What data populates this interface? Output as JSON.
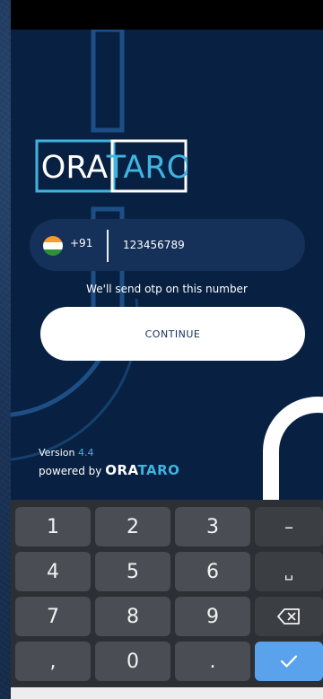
{
  "logo": {
    "text_left": "ORA",
    "text_right": "TARO"
  },
  "phone": {
    "country_code": "+91",
    "number": "123456789",
    "flag": "india-flag-icon"
  },
  "otp_note": "We'll send otp on this number",
  "continue_label": "CONTINUE",
  "footer": {
    "version_label": "Version",
    "version_number": "4.4",
    "powered_label": "powered by",
    "brand_left": "ORA",
    "brand_right": "TARO"
  },
  "keyboard": {
    "rows": [
      [
        "1",
        "2",
        "3",
        "–"
      ],
      [
        "4",
        "5",
        "6",
        "␣"
      ],
      [
        "7",
        "8",
        "9",
        "backspace-icon"
      ],
      [
        ",",
        "0",
        ".",
        "check-icon"
      ]
    ]
  },
  "colors": {
    "app_bg": "#082041",
    "accent": "#3fb4e0",
    "pill": "#15315a",
    "done_key": "#5aa2ec"
  }
}
